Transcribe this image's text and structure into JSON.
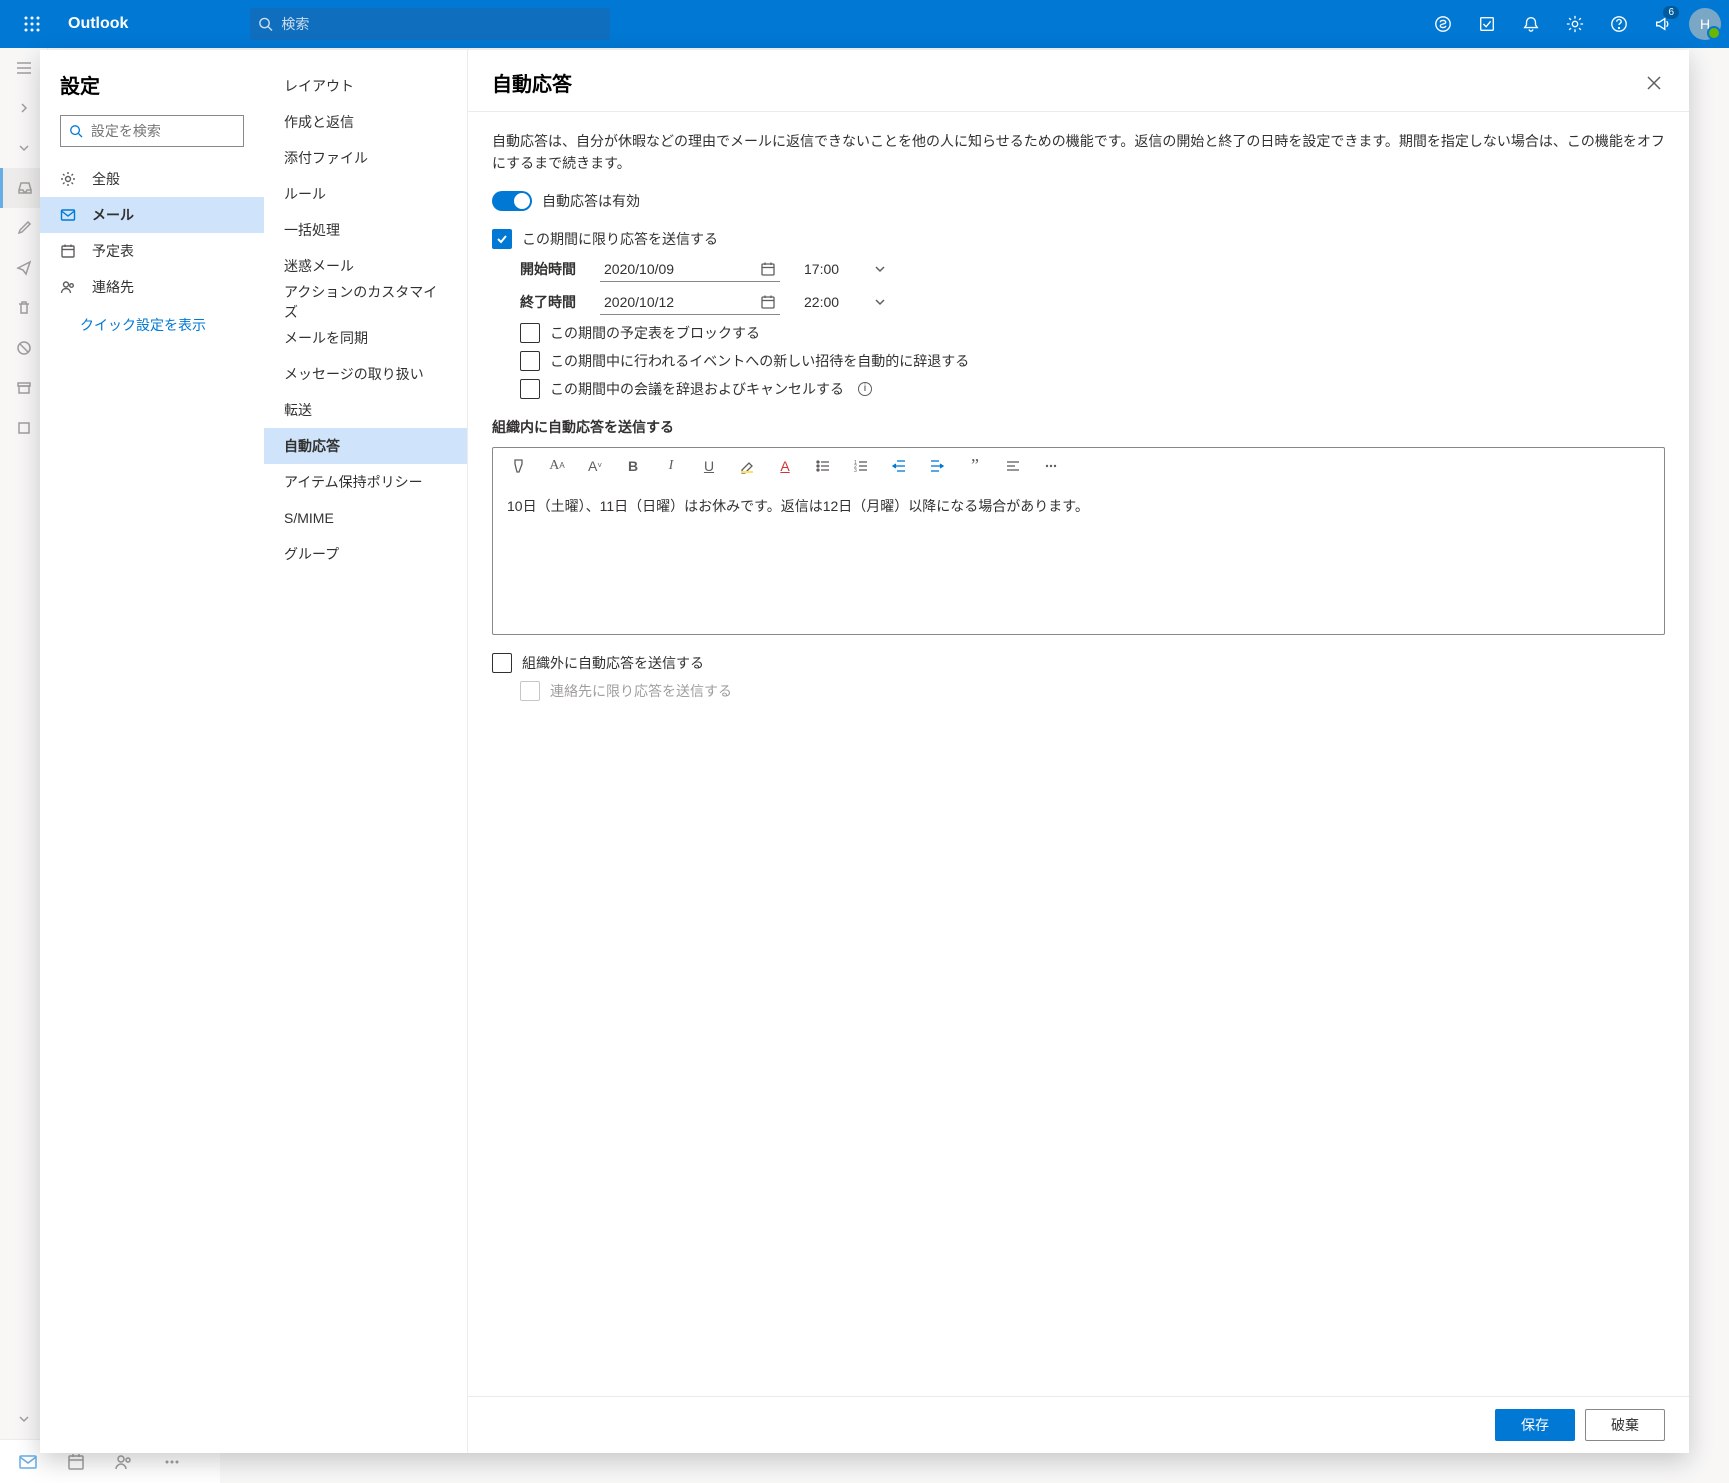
{
  "header": {
    "brand": "Outlook",
    "search_placeholder": "検索",
    "badge_count": "6",
    "avatar_initial": "H"
  },
  "settings": {
    "title": "設定",
    "search_placeholder": "設定を検索",
    "categories": [
      {
        "key": "general",
        "label": "全般"
      },
      {
        "key": "mail",
        "label": "メール"
      },
      {
        "key": "calendar",
        "label": "予定表"
      },
      {
        "key": "people",
        "label": "連絡先"
      }
    ],
    "quick_link": "クイック設定を表示",
    "mail_options": [
      "レイアウト",
      "作成と返信",
      "添付ファイル",
      "ルール",
      "一括処理",
      "迷惑メール",
      "アクションのカスタマイズ",
      "メールを同期",
      "メッセージの取り扱い",
      "転送",
      "自動応答",
      "アイテム保持ポリシー",
      "S/MIME",
      "グループ"
    ],
    "selected_mail_option_index": 10
  },
  "pane": {
    "title": "自動応答",
    "description": "自動応答は、自分が休暇などの理由でメールに返信できないことを他の人に知らせるための機能です。返信の開始と終了の日時を設定できます。期間を指定しない場合は、この機能をオフにするまで続きます。",
    "toggle_label": "自動応答は有効",
    "period_check_label": "この期間に限り応答を送信する",
    "start_label": "開始時間",
    "end_label": "終了時間",
    "start_date": "2020/10/09",
    "start_time": "17:00",
    "end_date": "2020/10/12",
    "end_time": "22:00",
    "block_calendar_label": "この期間の予定表をブロックする",
    "decline_new_label": "この期間中に行われるイベントへの新しい招待を自動的に辞退する",
    "cancel_meetings_label": "この期間中の会議を辞退およびキャンセルする",
    "inside_org_label": "組織内に自動応答を送信する",
    "editor_content": "10日（土曜）、11日（日曜）はお休みです。返信は12日（月曜）以降になる場合があります。",
    "outside_org_label": "組織外に自動応答を送信する",
    "contacts_only_label": "連絡先に限り応答を送信する",
    "save_label": "保存",
    "discard_label": "破棄"
  }
}
